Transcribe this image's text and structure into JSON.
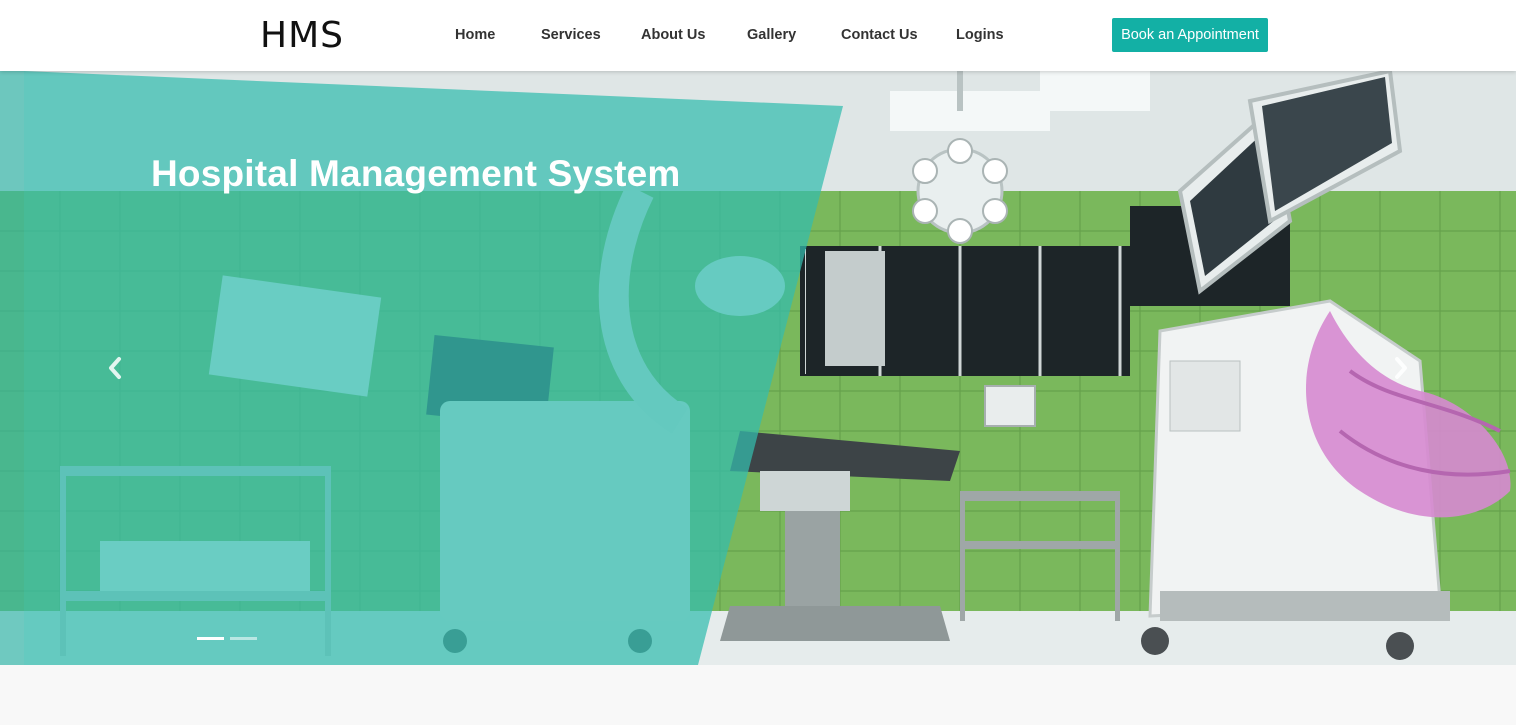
{
  "header": {
    "logo": "HMS",
    "nav": [
      {
        "label": "Home"
      },
      {
        "label": "Services"
      },
      {
        "label": "About Us"
      },
      {
        "label": "Gallery"
      },
      {
        "label": "Contact Us"
      },
      {
        "label": "Logins"
      }
    ],
    "cta_label": "Book an Appointment"
  },
  "hero": {
    "title": "Hospital Management System",
    "prev_icon": "chevron-left-icon",
    "next_icon": "chevron-right-icon",
    "slide_count": 2,
    "active_slide": 1
  },
  "colors": {
    "accent": "#13b0a5",
    "overlay": "#3fc6b8",
    "tile_green": "#7ab85c"
  }
}
